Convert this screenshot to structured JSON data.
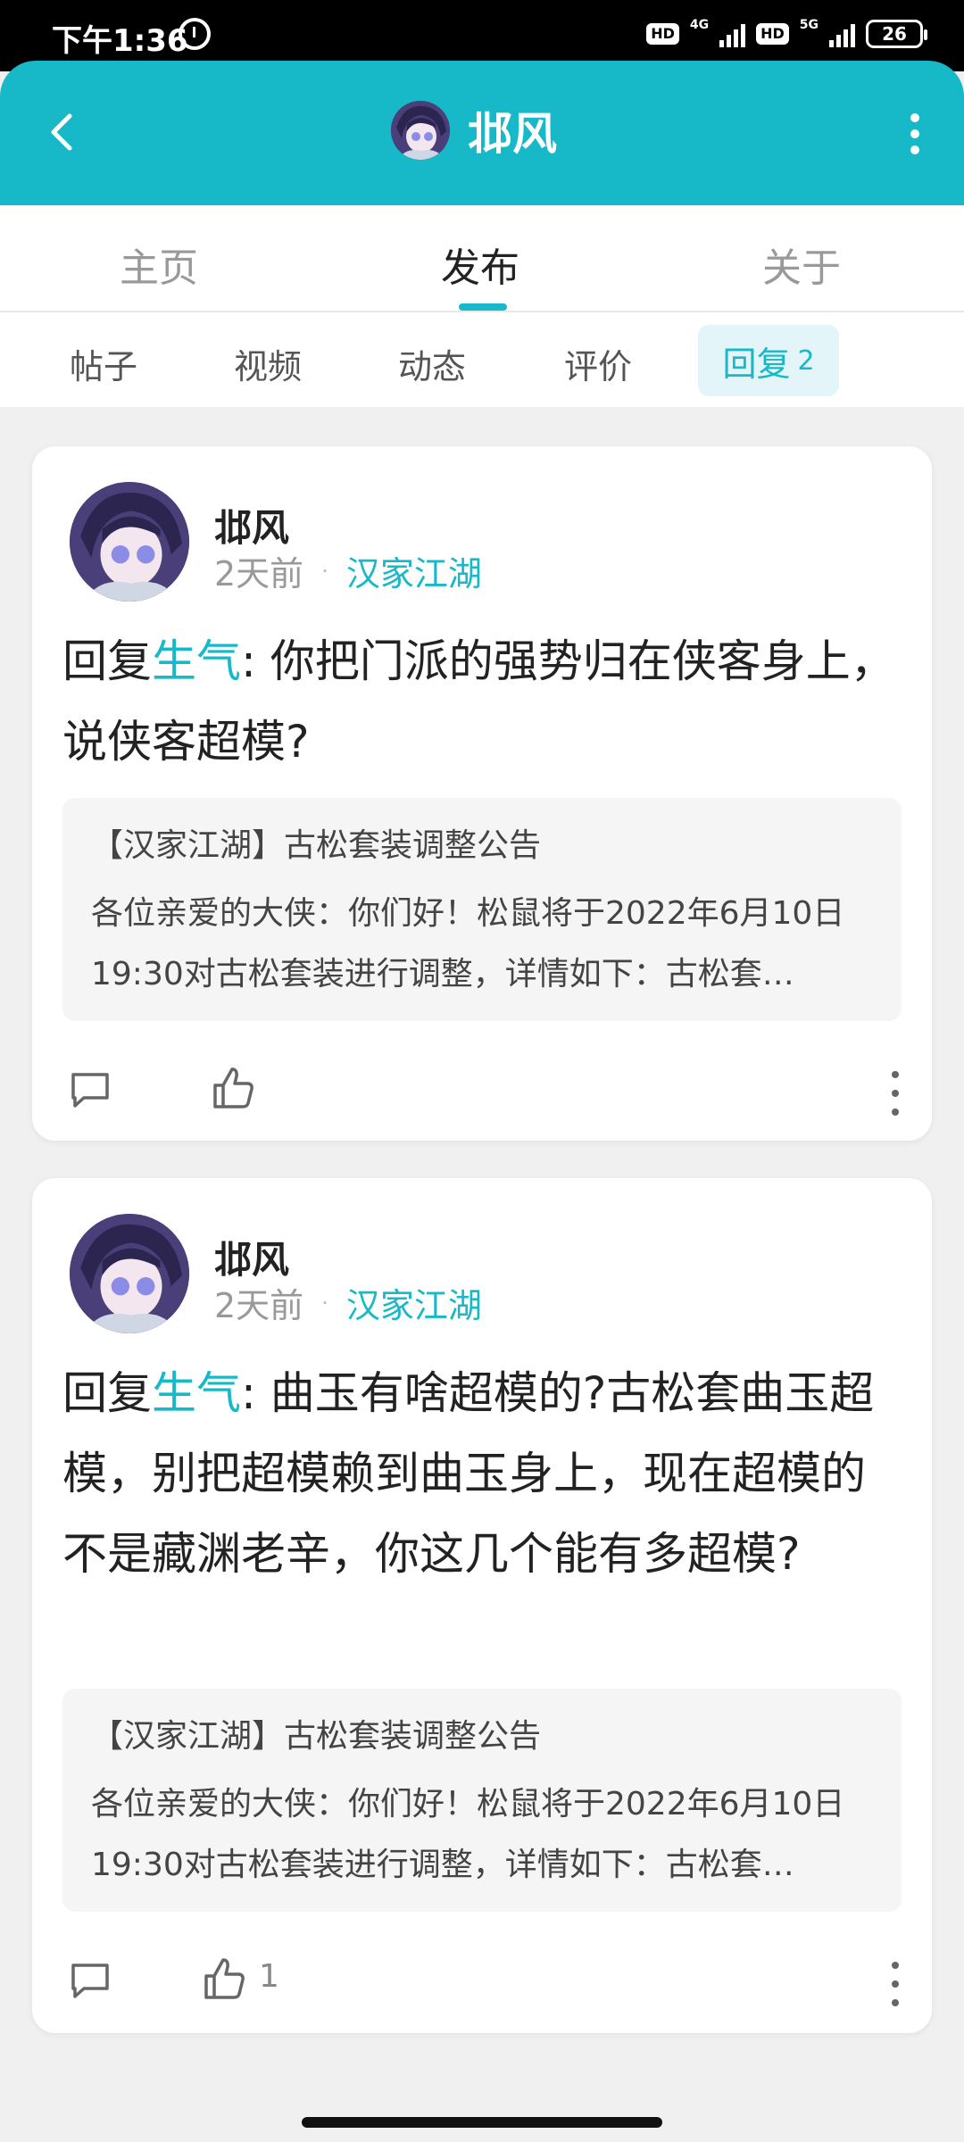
{
  "status_bar": {
    "time": "下午1:36",
    "hd1": "HD",
    "net1": "4G",
    "hd2": "HD",
    "net2": "5G",
    "battery": "26"
  },
  "header": {
    "title": "邶风",
    "back_icon": "chevron-left-icon",
    "more_icon": "more-vertical-icon"
  },
  "main_tabs": [
    {
      "label": "主页"
    },
    {
      "label": "发布",
      "active": true
    },
    {
      "label": "关于"
    }
  ],
  "sub_tabs": [
    {
      "label": "帖子"
    },
    {
      "label": "视频"
    },
    {
      "label": "动态"
    },
    {
      "label": "评价"
    },
    {
      "label": "回复",
      "count": "2",
      "active": true
    }
  ],
  "posts": [
    {
      "author": "邶风",
      "time": "2天前",
      "dot": "·",
      "board": "汉家江湖",
      "reply_prefix": "回复",
      "reply_to": "生气",
      "content": ": 你把门派的强势归在侠客身上，说侠客超模?",
      "quote_title": "【汉家江湖】古松套装调整公告",
      "quote_body": "各位亲爱的大侠：你们好！松鼠将于2022年6月10日19:30对古松套装进行调整，详情如下：古松套…",
      "likes": ""
    },
    {
      "author": "邶风",
      "time": "2天前",
      "dot": "·",
      "board": "汉家江湖",
      "reply_prefix": "回复",
      "reply_to": "生气",
      "content": ": 曲玉有啥超模的?古松套曲玉超模，别把超模赖到曲玉身上，现在超模的不是藏渊老辛，你这几个能有多超模?",
      "quote_title": "【汉家江湖】古松套装调整公告",
      "quote_body": "各位亲爱的大侠：你们好！松鼠将于2022年6月10日19:30对古松套装进行调整，详情如下：古松套…",
      "likes": "1"
    }
  ],
  "colors": {
    "accent": "#17b9c9",
    "header_bg": "#17b9c9",
    "page_bg": "#f0f0f0"
  }
}
